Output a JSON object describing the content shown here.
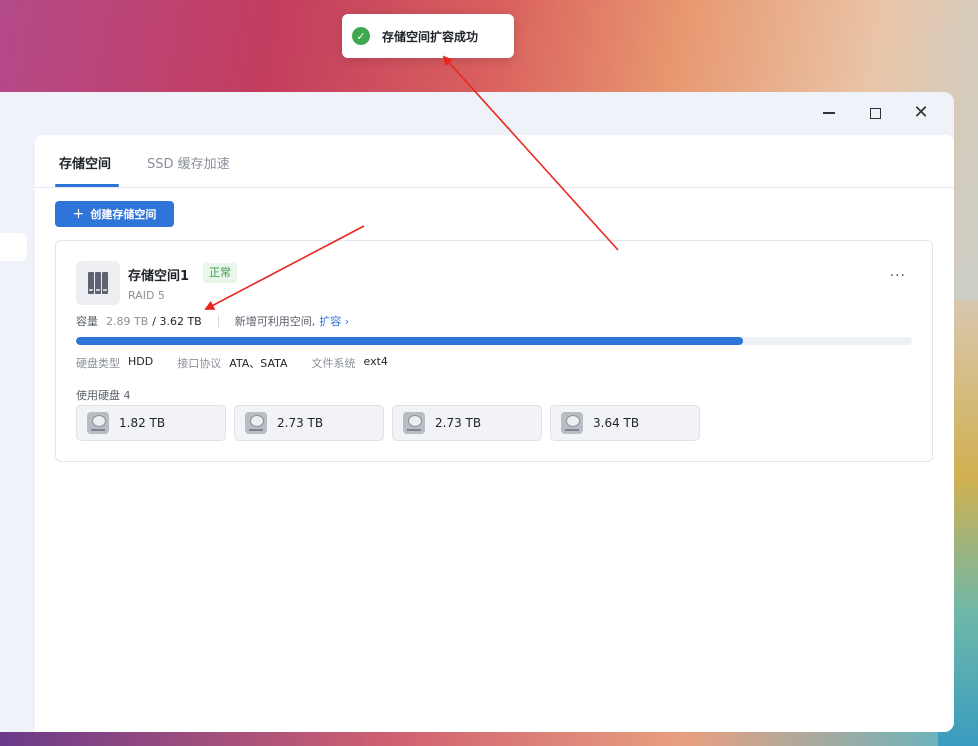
{
  "toast": {
    "message": "存储空间扩容成功"
  },
  "tabs": [
    {
      "label": "存储空间",
      "active": true
    },
    {
      "label": "SSD 缓存加速",
      "active": false
    }
  ],
  "toolbar": {
    "create_label": "创建存储空间",
    "plus": "+"
  },
  "window": {
    "minimize": "",
    "maximize": "",
    "close": "✕"
  },
  "pool": {
    "name": "存储空间1",
    "status": "正常",
    "raid": "RAID 5",
    "more": "···",
    "capacity_label": "容量",
    "used": "2.89 TB",
    "total": "/ 3.62 TB",
    "new_space_text": "新增可利用空间,",
    "expand_link": "扩容 ›",
    "usage_fraction": 0.798,
    "props": [
      {
        "label": "硬盘类型",
        "value": "HDD"
      },
      {
        "label": "接口协议",
        "value": "ATA、SATA"
      },
      {
        "label": "文件系统",
        "value": "ext4"
      }
    ],
    "disks_label": "使用硬盘 4",
    "disks": [
      {
        "size": "1.82 TB"
      },
      {
        "size": "2.73 TB"
      },
      {
        "size": "2.73 TB"
      },
      {
        "size": "3.64 TB"
      }
    ]
  },
  "colors": {
    "accent": "#2f74d9",
    "success": "#3ea84f",
    "annotation": "#e8271e"
  }
}
